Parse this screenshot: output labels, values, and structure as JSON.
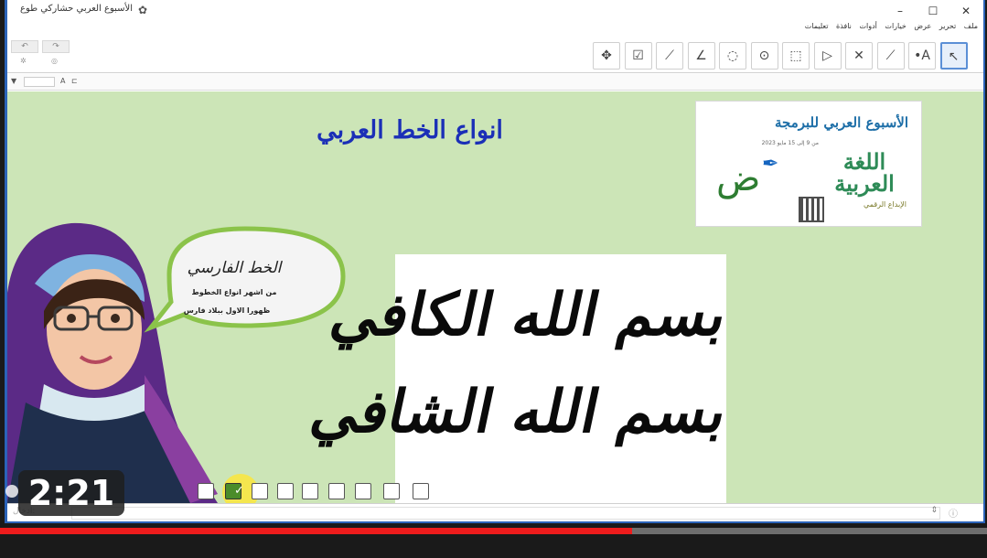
{
  "window": {
    "title": "الأسبوع العربي حشاركي طوع",
    "minimize_icon": "minimize-icon",
    "maximize_icon": "maximize-icon",
    "close_icon": "close-icon"
  },
  "menu": [
    "ملف",
    "تحرير",
    "عرض",
    "خيارات",
    "أدوات",
    "نافذة",
    "تعليمات"
  ],
  "toolbar": {
    "undo_icon": "undo-icon",
    "redo_icon": "redo-icon",
    "tools": [
      {
        "name": "move-graphics-icon",
        "glyph": "✥"
      },
      {
        "name": "checkbox-tool-icon",
        "glyph": "☑"
      },
      {
        "name": "reflect-line-icon",
        "glyph": "⟋"
      },
      {
        "name": "angle-tool-icon",
        "glyph": "∠"
      },
      {
        "name": "circle-three-points-icon",
        "glyph": "◌"
      },
      {
        "name": "circle-center-icon",
        "glyph": "⊙"
      },
      {
        "name": "polygon-tool-icon",
        "glyph": "⬚"
      },
      {
        "name": "polygon-icon",
        "glyph": "▷"
      },
      {
        "name": "perpendicular-line-icon",
        "glyph": "✕"
      },
      {
        "name": "line-tool-icon",
        "glyph": "⟋"
      },
      {
        "name": "point-tool-icon",
        "glyph": "•A"
      },
      {
        "name": "move-tool-icon",
        "glyph": "↖"
      }
    ]
  },
  "stylebar": {
    "toggle": "▼",
    "font_icon": "A",
    "label_icon": "⊏"
  },
  "canvas": {
    "title": "انواع الخط العربي",
    "banner": {
      "title": "الأسبوع العربي للبرمجة",
      "date": "من 9 إلى 15 مايو 2023",
      "lughah": "اللغة العربية",
      "ibdaa": "الإبداع الرقمي",
      "dad_letter": "ض"
    },
    "bubble": {
      "title": "الخط الفارسي",
      "line1": "من اشهر انواع الخطوط",
      "line2": "ظهورا الاول ببلاد فارس"
    },
    "calligraphy": {
      "line1": "بسم الله الكافي",
      "line2": "بسم الله الشافي"
    },
    "slides": {
      "count": 9,
      "current": 2
    }
  },
  "video": {
    "time": "2:21",
    "progress": 0.64
  }
}
